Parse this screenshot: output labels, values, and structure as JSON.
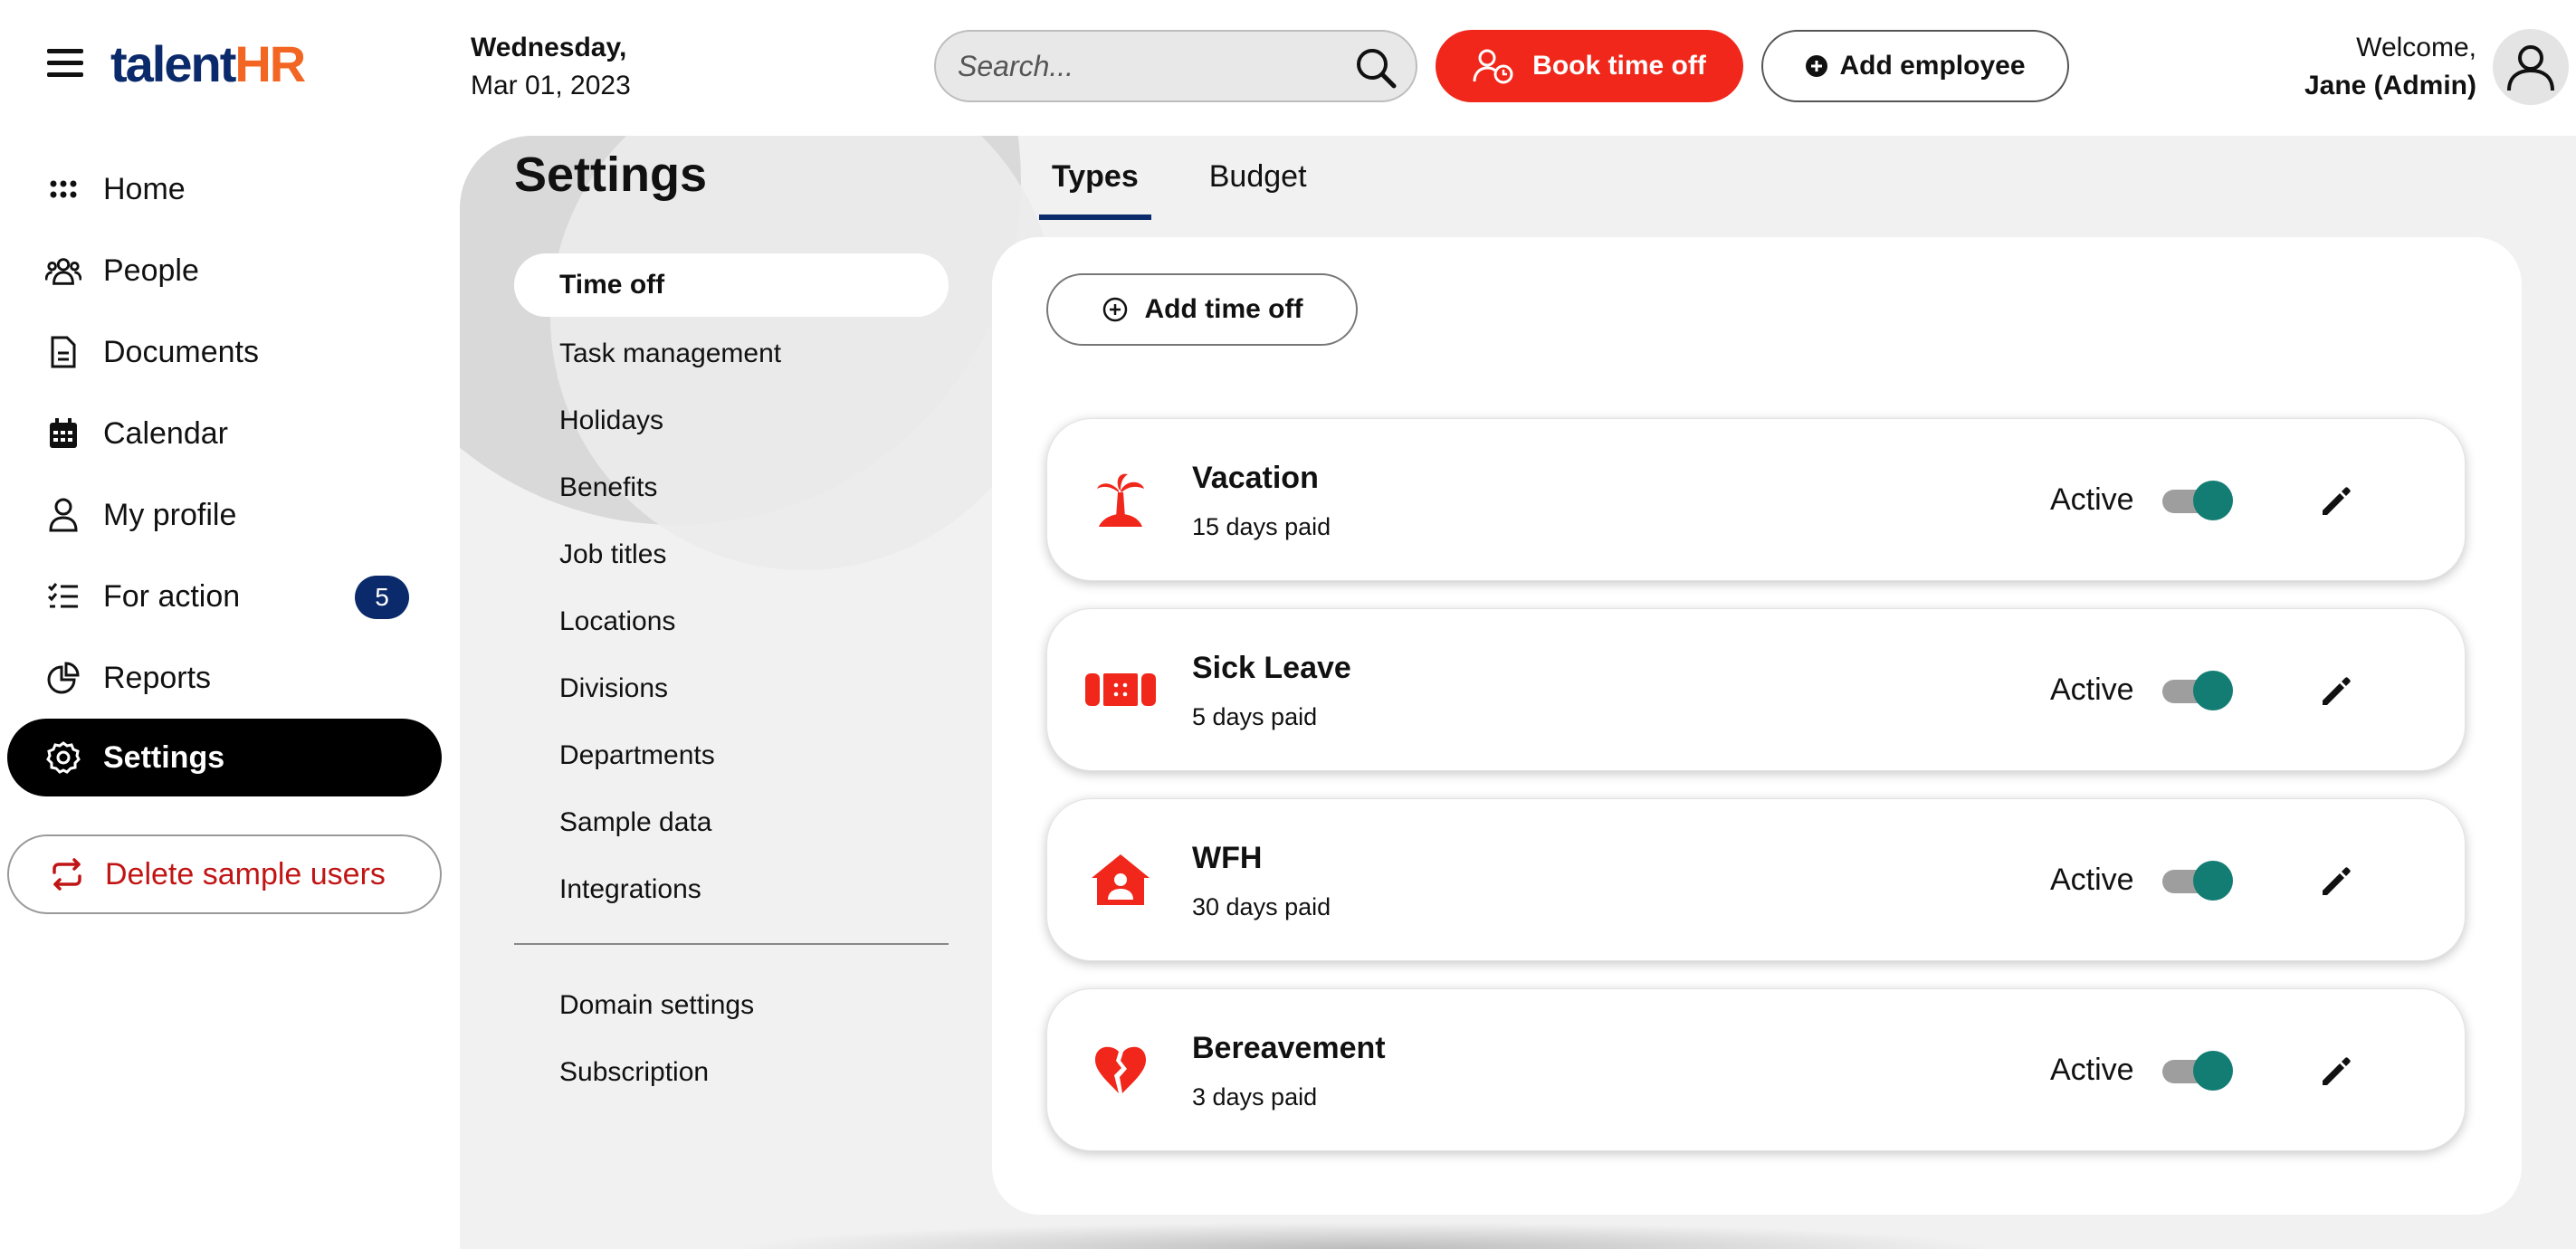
{
  "app": {
    "logo_part1": "talent",
    "logo_part2": "HR"
  },
  "header": {
    "date_day": "Wednesday,",
    "date_full": "Mar 01, 2023",
    "search_placeholder": "Search...",
    "book_time_off_label": "Book time off",
    "add_employee_label": "Add employee",
    "welcome_text": "Welcome,",
    "user_name": "Jane (Admin)"
  },
  "sidebar": {
    "items": [
      {
        "label": "Home",
        "icon": "grid-icon"
      },
      {
        "label": "People",
        "icon": "people-icon"
      },
      {
        "label": "Documents",
        "icon": "document-icon"
      },
      {
        "label": "Calendar",
        "icon": "calendar-icon"
      },
      {
        "label": "My profile",
        "icon": "user-icon"
      },
      {
        "label": "For action",
        "icon": "checklist-icon",
        "badge": "5"
      },
      {
        "label": "Reports",
        "icon": "pie-chart-icon"
      },
      {
        "label": "Settings",
        "icon": "gear-icon",
        "active": true
      }
    ],
    "delete_sample_label": "Delete sample users"
  },
  "settings": {
    "title": "Settings",
    "menu": [
      "Time off",
      "Task management",
      "Holidays",
      "Benefits",
      "Job titles",
      "Locations",
      "Divisions",
      "Departments",
      "Sample data",
      "Integrations"
    ],
    "menu_secondary": [
      "Domain settings",
      "Subscription"
    ],
    "active_menu": "Time off"
  },
  "tabs": [
    {
      "label": "Types",
      "active": true
    },
    {
      "label": "Budget",
      "active": false
    }
  ],
  "panel": {
    "add_time_off_label": "Add time off",
    "time_off_types": [
      {
        "name": "Vacation",
        "days": "15 days paid",
        "status": "Active",
        "enabled": true,
        "icon": "palm-tree-icon"
      },
      {
        "name": "Sick Leave",
        "days": "5 days paid",
        "status": "Active",
        "enabled": true,
        "icon": "bandage-icon"
      },
      {
        "name": "WFH",
        "days": "30 days paid",
        "status": "Active",
        "enabled": true,
        "icon": "house-user-icon"
      },
      {
        "name": "Bereavement",
        "days": "3 days paid",
        "status": "Active",
        "enabled": true,
        "icon": "broken-heart-icon"
      }
    ]
  },
  "colors": {
    "accent_red": "#f0271a",
    "brand_navy": "#0b2a6b",
    "brand_orange": "#f26522",
    "toggle_on": "#137d74",
    "danger_text": "#c11515"
  }
}
